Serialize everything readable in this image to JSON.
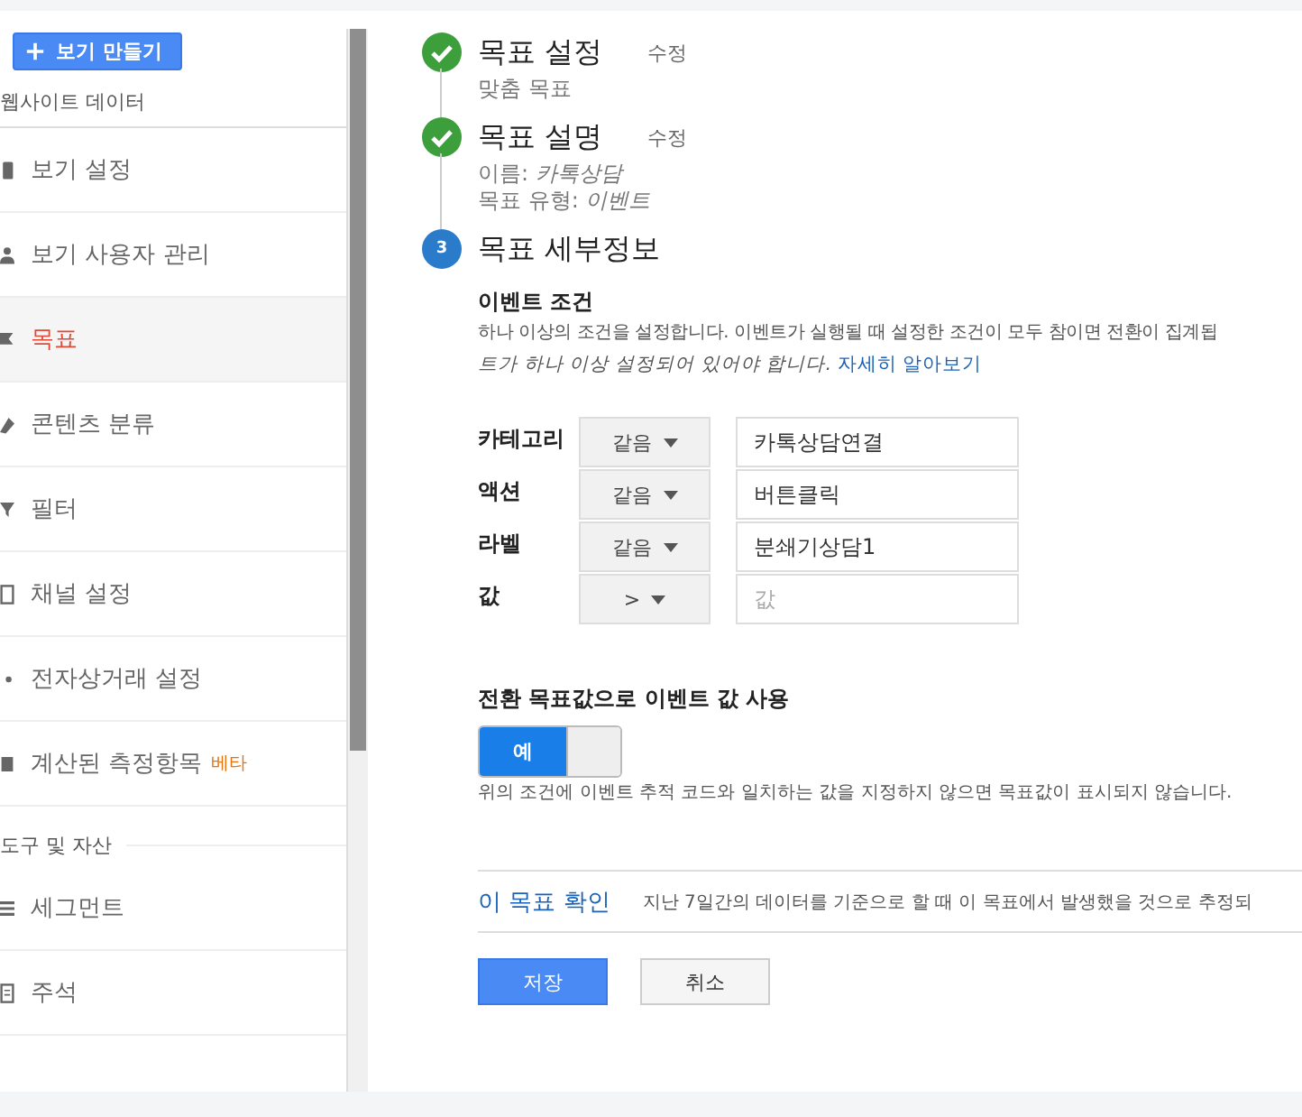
{
  "sidebar": {
    "create_button": "보기 만들기",
    "section_title": "웹사이트 데이터",
    "items": [
      {
        "label": "보기 설정",
        "kind": "doc",
        "selected": false
      },
      {
        "label": "보기 사용자 관리",
        "kind": "user",
        "selected": false
      },
      {
        "label": "목표",
        "kind": "flag",
        "selected": true
      },
      {
        "label": "콘텐츠 분류",
        "kind": "tag",
        "selected": false
      },
      {
        "label": "필터",
        "kind": "filter",
        "selected": false
      },
      {
        "label": "채널 설정",
        "kind": "box",
        "selected": false
      },
      {
        "label": "전자상거래 설정",
        "kind": "cart",
        "selected": false
      },
      {
        "label": "계산된 측정항목",
        "kind": "calc",
        "selected": false,
        "badge": "베타"
      }
    ],
    "section2_title": "도구 및 자산",
    "items2": [
      {
        "label": "세그먼트",
        "kind": "lines",
        "selected": false
      },
      {
        "label": "주석",
        "kind": "note",
        "selected": false
      }
    ]
  },
  "steps": [
    {
      "kind": "done",
      "title": "목표 설정",
      "edit": "수정",
      "lines": [
        {
          "label": "맞춤 목표"
        }
      ]
    },
    {
      "kind": "done",
      "title": "목표 설명",
      "edit": "수정",
      "lines": [
        {
          "label": "이름: ",
          "value": "카톡상담"
        },
        {
          "label": "목표 유형: ",
          "value": "이벤트"
        }
      ]
    },
    {
      "kind": "current",
      "number": "3",
      "title": "목표 세부정보"
    }
  ],
  "event_conditions": {
    "title": "이벤트 조건",
    "description": "하나 이상의 조건을 설정합니다. 이벤트가 실행될 때 설정한 조건이 모두 참이면 전환이 집계됩",
    "note": "트가 하나 이상 설정되어 있어야 합니다.",
    "link": "자세히 알아보기",
    "rows": [
      {
        "label": "카테고리",
        "operator": "같음",
        "value": "카톡상담연결"
      },
      {
        "label": "액션",
        "operator": "같음",
        "value": "버튼클릭"
      },
      {
        "label": "라벨",
        "operator": "같음",
        "value": "분쇄기상담1"
      },
      {
        "label": "값",
        "operator": ">",
        "placeholder": "값"
      }
    ]
  },
  "use_value": {
    "title": "전환 목표값으로 이벤트 값 사용",
    "toggle_label": "예",
    "on": true,
    "help": "위의 조건에 이벤트 추적 코드와 일치하는 값을 지정하지 않으면 목표값이 표시되지 않습니다."
  },
  "verify": {
    "link": "이 목표 확인",
    "text": "지난 7일간의 데이터를 기준으로 할 때 이 목표에서 발생했을 것으로 추정되"
  },
  "buttons": [
    {
      "kind": "primary",
      "label": "저장"
    },
    {
      "kind": "secondary",
      "label": "취소"
    }
  ]
}
